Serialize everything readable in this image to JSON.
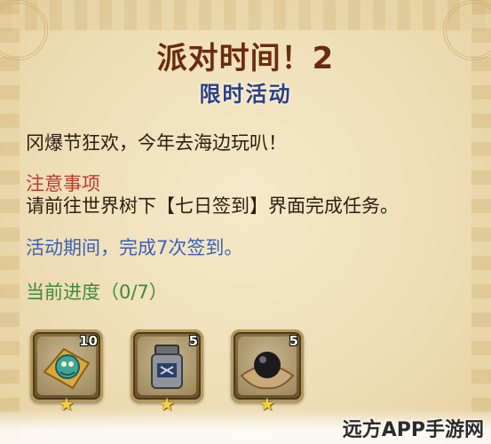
{
  "header": {
    "title": "派对时间！2",
    "subtitle": "限时活动"
  },
  "body": {
    "intro": "冈爆节狂欢，今年去海边玩叭！",
    "notice_heading": "注意事项",
    "notice_text": "请前往世界树下【七日签到】界面完成任务。",
    "period_text": "活动期间，完成7次签到。",
    "progress_text": "当前进度（0/7）"
  },
  "progress": {
    "current": 0,
    "total": 7
  },
  "rewards": [
    {
      "icon": "puzzle-dragon-icon",
      "count": "10"
    },
    {
      "icon": "jar-icon",
      "count": "5"
    },
    {
      "icon": "black-pearl-icon",
      "count": "5"
    }
  ],
  "watermark": "远方APP手游网",
  "colors": {
    "title": "#6b2a12",
    "subtitle": "#2c3f8a",
    "notice": "#c0392b",
    "period": "#3a5fb8",
    "progress": "#3e8a3a",
    "star": "#f0d14a"
  }
}
